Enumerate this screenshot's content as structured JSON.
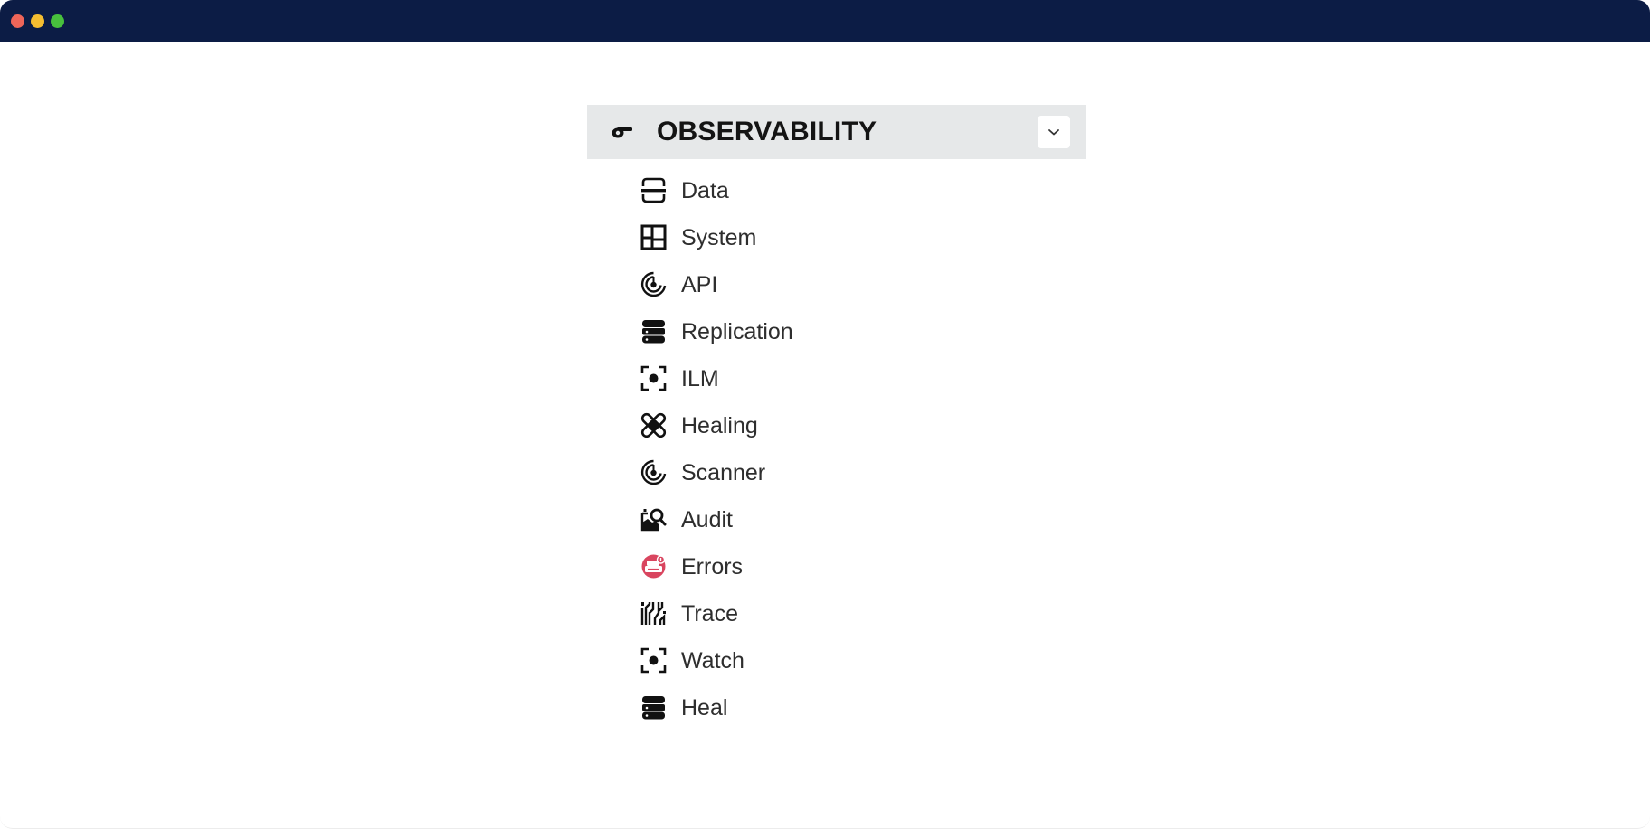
{
  "window": {
    "controls": [
      "close",
      "minimize",
      "maximize"
    ]
  },
  "panel": {
    "header": {
      "icon": "whistle-icon",
      "title": "OBSERVABILITY",
      "toggle": "chevron-down-icon"
    },
    "items": [
      {
        "label": "Data",
        "icon": "data-icon"
      },
      {
        "label": "System",
        "icon": "grid-layout-icon"
      },
      {
        "label": "API",
        "icon": "radar-icon"
      },
      {
        "label": "Replication",
        "icon": "database-icon"
      },
      {
        "label": "ILM",
        "icon": "focus-dot-icon"
      },
      {
        "label": "Healing",
        "icon": "bandage-icon"
      },
      {
        "label": "Scanner",
        "icon": "radar-icon"
      },
      {
        "label": "Audit",
        "icon": "image-search-icon"
      },
      {
        "label": "Errors",
        "icon": "error-drive-icon",
        "color": "#d9455f"
      },
      {
        "label": "Trace",
        "icon": "circuit-trace-icon"
      },
      {
        "label": "Watch",
        "icon": "focus-dot-icon"
      },
      {
        "label": "Heal",
        "icon": "database-icon"
      }
    ]
  }
}
